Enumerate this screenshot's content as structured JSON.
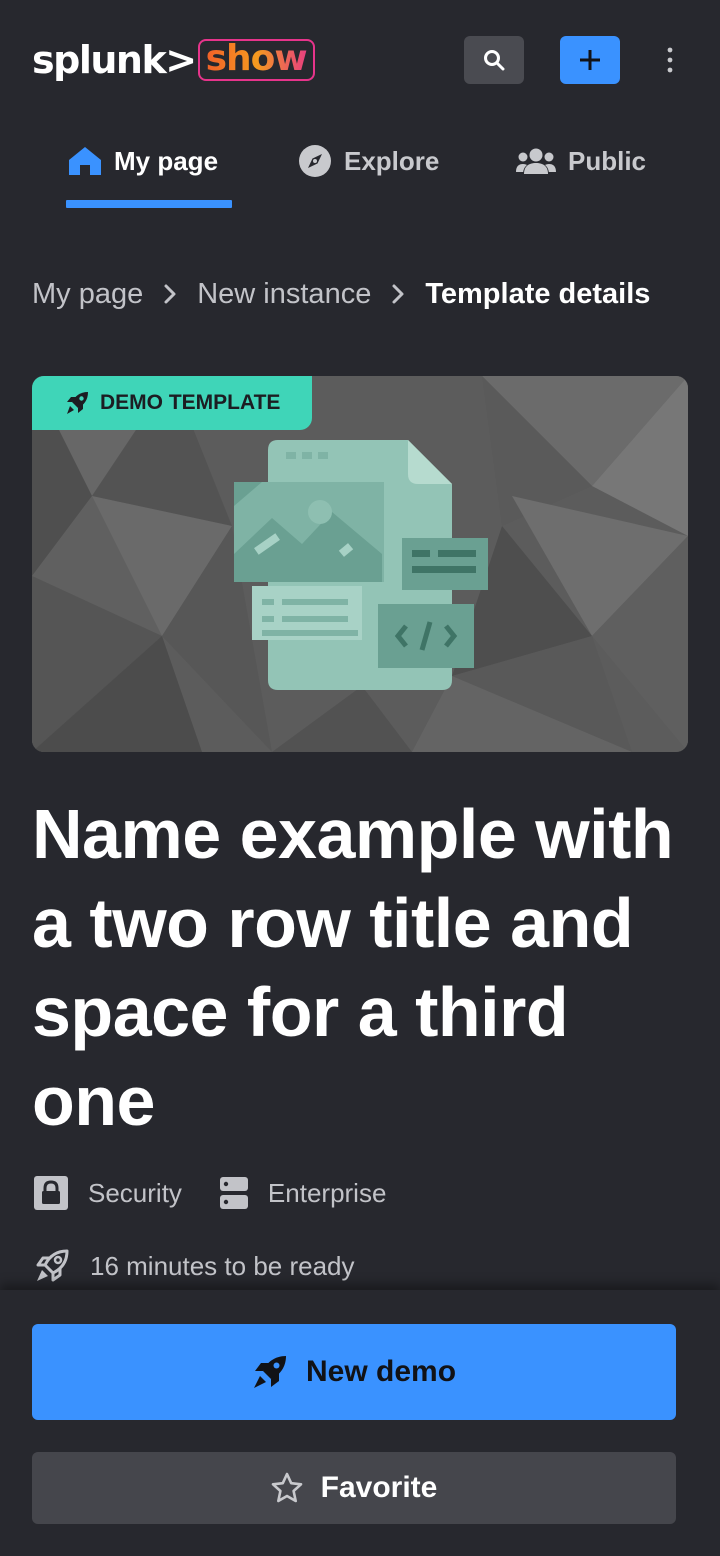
{
  "header": {
    "logo_primary": "splunk>",
    "logo_secondary": "show"
  },
  "tabs": [
    {
      "label": "My page",
      "icon": "home-icon",
      "active": true
    },
    {
      "label": "Explore",
      "icon": "compass-icon",
      "active": false
    },
    {
      "label": "Public",
      "icon": "users-icon",
      "active": false
    }
  ],
  "breadcrumb": {
    "items": [
      "My page",
      "New instance"
    ],
    "current": "Template details"
  },
  "hero": {
    "badge_label": "DEMO TEMPLATE",
    "badge_icon": "rocket-icon"
  },
  "template": {
    "title": "Name example with a two row title and space for a third one",
    "category": "Security",
    "tier": "Enterprise",
    "ready_time": "16 minutes to be ready"
  },
  "actions": {
    "primary_label": "New demo",
    "secondary_label": "Favorite"
  },
  "colors": {
    "background": "#27282e",
    "accent": "#3a92ff",
    "badge": "#3fd5b8",
    "secondary_button": "#45464c"
  }
}
